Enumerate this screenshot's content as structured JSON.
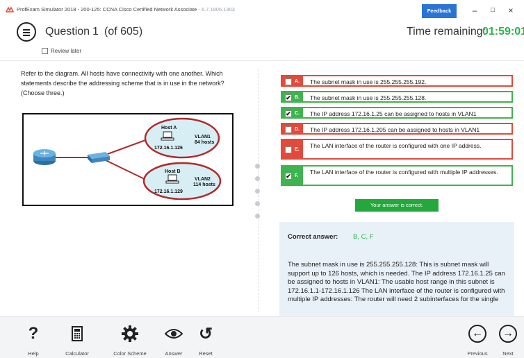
{
  "window": {
    "title": "ProfExam Simulator 2018 - 200-125: CCNA Cisco Certified Network Associate",
    "version": " - 6.7.1806.1303",
    "feedback_label": "Feedback",
    "minimize": "–",
    "maximize": "□",
    "close": "×"
  },
  "header": {
    "question_label": "Question",
    "question_number": "1",
    "question_of": "(of 605)",
    "time_label": "Time remaining:",
    "time_value": "01:59:01",
    "review_label": "Review later"
  },
  "question": {
    "text": "Refer to the diagram. All hosts have connectivity with one another. Which statements describe the addressing scheme that is in use in the network? (Choose three.)"
  },
  "diagram": {
    "host_a_label": "Host A",
    "host_a_ip": "172.16.1.126",
    "vlan1_label": "VLAN1",
    "vlan1_hosts": "84 hosts",
    "host_b_label": "Host B",
    "host_b_ip": "172.16.1.129",
    "vlan2_label": "VLAN2",
    "vlan2_hosts": "114 hosts"
  },
  "options": [
    {
      "letter": "A.",
      "checked": false,
      "status": "incorrect",
      "check_mark": "",
      "text": "The subnet mask in use is 255.255.255.192."
    },
    {
      "letter": "B.",
      "checked": true,
      "status": "correct",
      "check_mark": "✔",
      "text": "The subnet mask in use is 255.255.255.128."
    },
    {
      "letter": "C.",
      "checked": true,
      "status": "correct",
      "check_mark": "✔",
      "text": "The IP address 172.16.1.25 can be assigned to hosts in VLAN1"
    },
    {
      "letter": "D.",
      "checked": false,
      "status": "incorrect",
      "check_mark": "",
      "text": "The IP address 172.16.1.205 can be assigned to hosts in VLAN1"
    },
    {
      "letter": "E.",
      "checked": false,
      "status": "incorrect",
      "check_mark": "",
      "text": "The LAN interface of the router is configured with one IP address."
    },
    {
      "letter": "F.",
      "checked": true,
      "status": "correct",
      "check_mark": "✔",
      "text": "The LAN interface of the router is configured with multiple IP addresses."
    }
  ],
  "result": {
    "message": "Your answer is correct."
  },
  "explanation": {
    "label": "Correct answer:",
    "answer": "B, C, F",
    "body": "The subnet mask in use is 255.255.255.128: This is subnet mask will support up to 126 hosts, which is needed. The IP address 172.16.1.25 can be assigned to hosts in VLAN1: The usable host range in this subnet is 172.16.1.1-172.16.1.126 The LAN interface of the router is configured with multiple IP addresses: The router will need 2 subinterfaces for the single"
  },
  "toolbar": {
    "help": "Help",
    "help_glyph": "?",
    "calculator": "Calculator",
    "color_scheme": "Color Scheme",
    "answer": "Answer",
    "reset": "Reset",
    "reset_glyph": "↺",
    "previous": "Previous",
    "previous_glyph": "←",
    "next": "Next",
    "next_glyph": "→"
  },
  "colors": {
    "correct": "#3fb34f",
    "incorrect": "#e24a3b",
    "timer": "#2bb24c",
    "feedback": "#2a74d6"
  }
}
